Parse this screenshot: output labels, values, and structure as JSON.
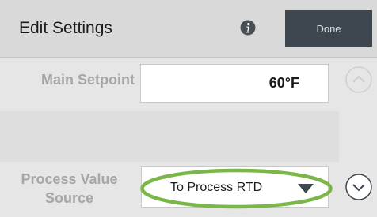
{
  "header": {
    "title": "Edit Settings",
    "done_label": "Done",
    "info_icon": "info-icon"
  },
  "settings": {
    "main_setpoint": {
      "label": "Main Setpoint",
      "value": "60°F"
    },
    "process_value_source": {
      "label_line1": "Process Value",
      "label_line2": "Source",
      "selected": "To Process RTD"
    }
  },
  "icons": {
    "scroll_up": "chevron-up-icon",
    "scroll_down": "chevron-down-icon",
    "dropdown": "triangle-down-icon"
  },
  "colors": {
    "done_button": "#3e4650",
    "highlight": "#7ab648"
  }
}
